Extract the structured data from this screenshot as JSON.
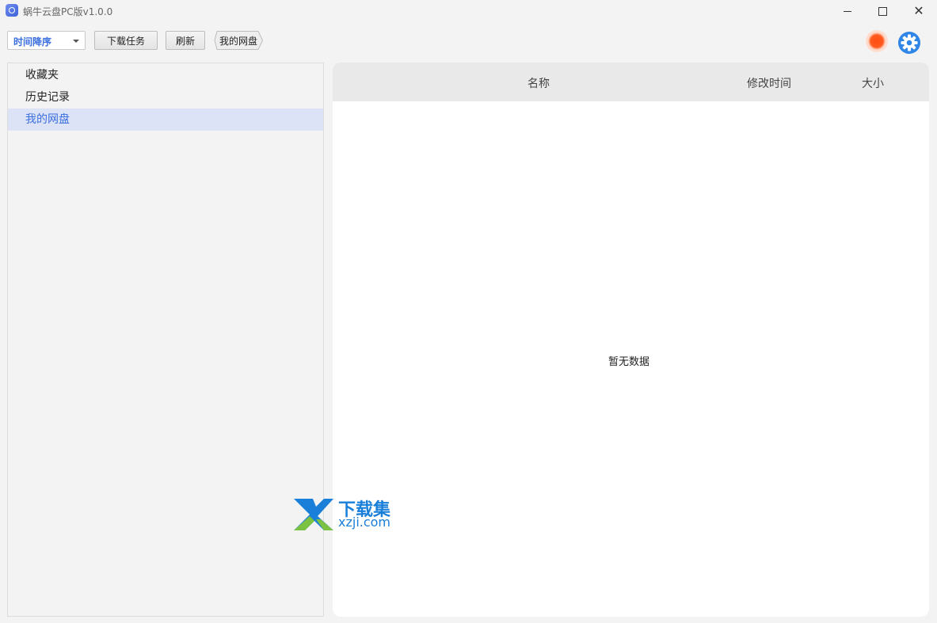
{
  "window": {
    "title": "蜗牛云盘PC版v1.0.0"
  },
  "toolbar": {
    "sort_label": "时间降序",
    "download_tasks": "下载任务",
    "refresh": "刷新",
    "breadcrumb": "我的网盘"
  },
  "sidebar": {
    "items": [
      {
        "label": "收藏夹"
      },
      {
        "label": "历史记录"
      },
      {
        "label": "我的网盘"
      }
    ],
    "active_index": 2
  },
  "table": {
    "columns": [
      "名称",
      "修改时间",
      "大小"
    ],
    "empty_text": "暂无数据"
  },
  "watermark": {
    "title": "下载集",
    "url": "xzji.com"
  },
  "colors": {
    "accent": "#3a6fe0",
    "record": "#ff4d12"
  }
}
